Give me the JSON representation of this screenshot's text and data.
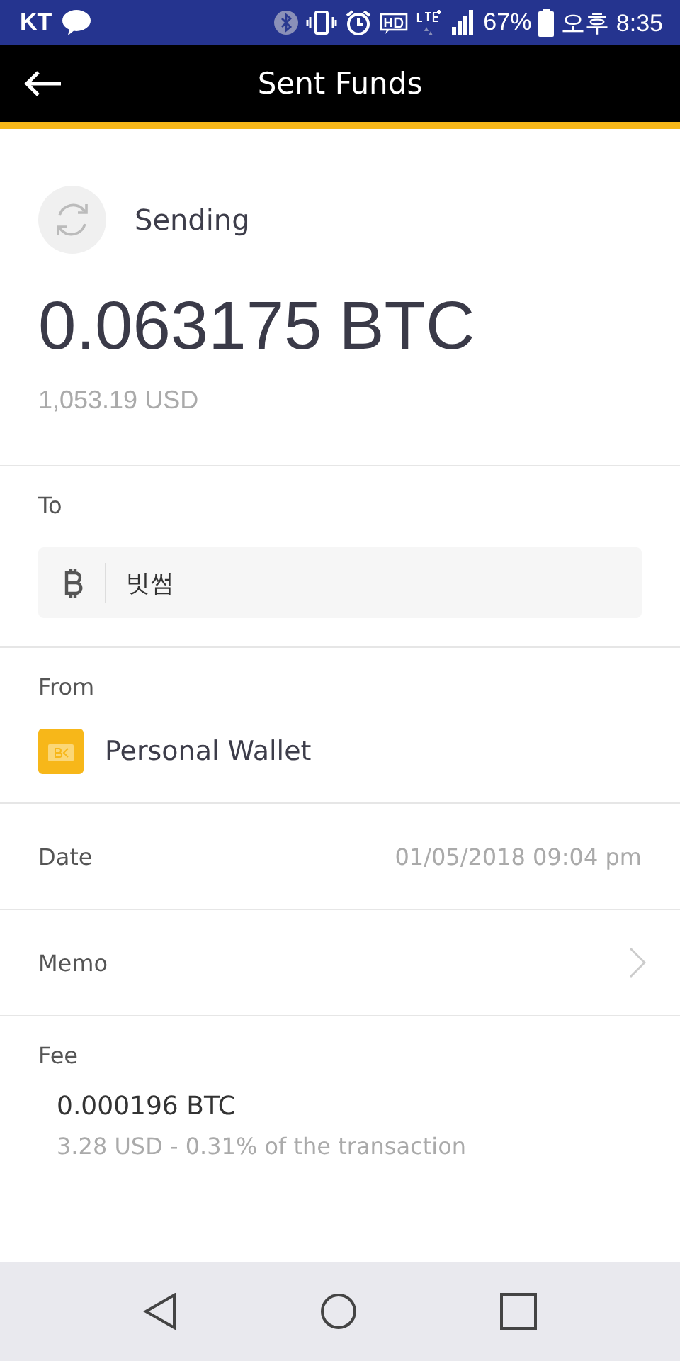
{
  "status_bar": {
    "carrier": "KT",
    "battery": "67%",
    "time": "오후 8:35"
  },
  "app_bar": {
    "title": "Sent Funds"
  },
  "status": {
    "label": "Sending"
  },
  "amount": {
    "value": "0.063175",
    "unit": "BTC",
    "fiat": "1,053.19 USD"
  },
  "to": {
    "label": "To",
    "recipient": "빗썸"
  },
  "from": {
    "label": "From",
    "wallet": "Personal Wallet"
  },
  "date": {
    "label": "Date",
    "value": "01/05/2018 09:04 pm"
  },
  "memo": {
    "label": "Memo"
  },
  "fee": {
    "label": "Fee",
    "amount": "0.000196 BTC",
    "detail": "3.28 USD - 0.31% of the transaction"
  }
}
